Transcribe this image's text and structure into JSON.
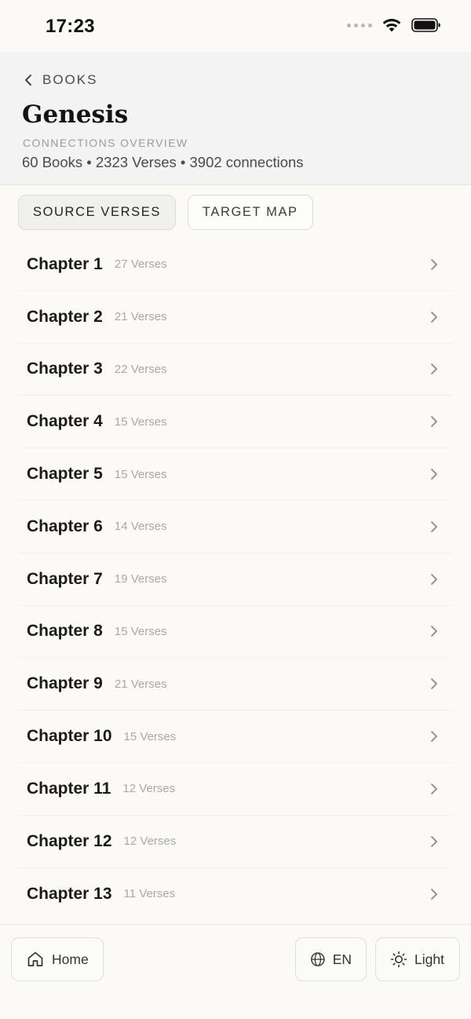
{
  "status": {
    "time": "17:23"
  },
  "header": {
    "back_label": "BOOKS",
    "title": "Genesis",
    "overline": "CONNECTIONS OVERVIEW",
    "stats": "60 Books • 2323 Verses • 3902 connections"
  },
  "tabs": [
    {
      "label": "SOURCE VERSES",
      "active": true
    },
    {
      "label": "TARGET MAP",
      "active": false
    }
  ],
  "chapters": [
    {
      "name": "Chapter 1",
      "count": "27 Verses"
    },
    {
      "name": "Chapter 2",
      "count": "21 Verses"
    },
    {
      "name": "Chapter 3",
      "count": "22 Verses"
    },
    {
      "name": "Chapter 4",
      "count": "15 Verses"
    },
    {
      "name": "Chapter 5",
      "count": "15 Verses"
    },
    {
      "name": "Chapter 6",
      "count": "14 Verses"
    },
    {
      "name": "Chapter 7",
      "count": "19 Verses"
    },
    {
      "name": "Chapter 8",
      "count": "15 Verses"
    },
    {
      "name": "Chapter 9",
      "count": "21 Verses"
    },
    {
      "name": "Chapter 10",
      "count": "15 Verses"
    },
    {
      "name": "Chapter 11",
      "count": "12 Verses"
    },
    {
      "name": "Chapter 12",
      "count": "12 Verses"
    },
    {
      "name": "Chapter 13",
      "count": "11 Verses"
    }
  ],
  "bottom": {
    "home_label": "Home",
    "language_label": "EN",
    "theme_label": "Light"
  },
  "icons": {
    "back": "chevron-left-icon",
    "row_chevron": "chevron-right-icon",
    "home": "house-icon",
    "language": "globe-icon",
    "theme": "sun-icon"
  },
  "colors": {
    "background": "#fbfaf7",
    "header_background": "#f3f3f3",
    "muted_text": "#a8a8a8"
  }
}
